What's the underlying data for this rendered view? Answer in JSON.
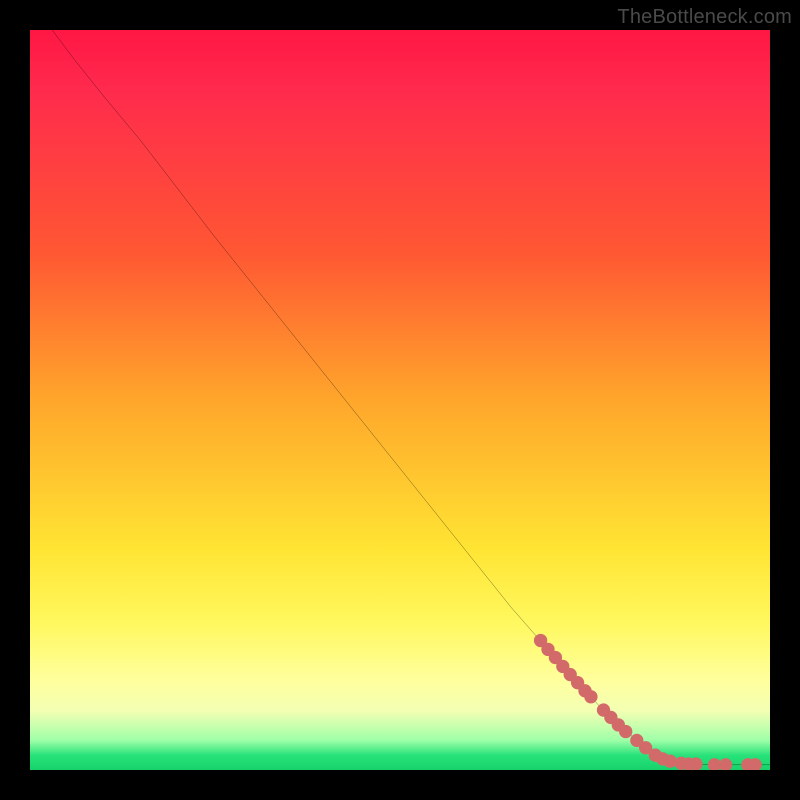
{
  "watermark": "TheBottleneck.com",
  "chart_data": {
    "type": "line",
    "title": "",
    "xlabel": "",
    "ylabel": "",
    "xlim": [
      0,
      100
    ],
    "ylim": [
      0,
      100
    ],
    "curve": [
      {
        "x": 3,
        "y": 100
      },
      {
        "x": 6,
        "y": 96
      },
      {
        "x": 10,
        "y": 91
      },
      {
        "x": 15,
        "y": 85
      },
      {
        "x": 25,
        "y": 72
      },
      {
        "x": 35,
        "y": 59.5
      },
      {
        "x": 45,
        "y": 47
      },
      {
        "x": 55,
        "y": 34.5
      },
      {
        "x": 65,
        "y": 22
      },
      {
        "x": 72,
        "y": 14
      },
      {
        "x": 78,
        "y": 7.5
      },
      {
        "x": 82,
        "y": 4
      },
      {
        "x": 85,
        "y": 1.6
      },
      {
        "x": 88,
        "y": 0.8
      },
      {
        "x": 92,
        "y": 0.7
      },
      {
        "x": 96,
        "y": 0.7
      },
      {
        "x": 100,
        "y": 0.7
      }
    ],
    "markers": [
      {
        "x": 69,
        "y": 17.5
      },
      {
        "x": 70,
        "y": 16.3
      },
      {
        "x": 71,
        "y": 15.2
      },
      {
        "x": 72,
        "y": 14.0
      },
      {
        "x": 73,
        "y": 12.9
      },
      {
        "x": 74,
        "y": 11.8
      },
      {
        "x": 75,
        "y": 10.7
      },
      {
        "x": 75.8,
        "y": 9.9
      },
      {
        "x": 77.5,
        "y": 8.1
      },
      {
        "x": 78.5,
        "y": 7.1
      },
      {
        "x": 79.5,
        "y": 6.1
      },
      {
        "x": 80.5,
        "y": 5.2
      },
      {
        "x": 82,
        "y": 4.0
      },
      {
        "x": 83.2,
        "y": 3.0
      },
      {
        "x": 84.5,
        "y": 2.0
      },
      {
        "x": 85.5,
        "y": 1.5
      },
      {
        "x": 86.5,
        "y": 1.2
      },
      {
        "x": 88,
        "y": 0.9
      },
      {
        "x": 89,
        "y": 0.8
      },
      {
        "x": 90,
        "y": 0.8
      },
      {
        "x": 92.5,
        "y": 0.7
      },
      {
        "x": 94,
        "y": 0.7
      },
      {
        "x": 97,
        "y": 0.7
      },
      {
        "x": 98,
        "y": 0.7
      }
    ],
    "marker_color": "#d36a6a",
    "curve_color": "#000000"
  }
}
